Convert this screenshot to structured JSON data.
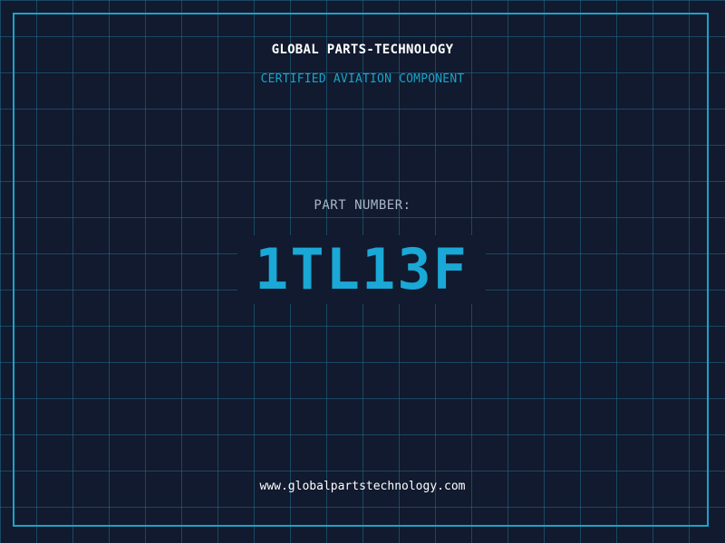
{
  "label": {
    "company": "GLOBAL PARTS-TECHNOLOGY",
    "subtitle": "CERTIFIED AVIATION COMPONENT",
    "part_number_label": "PART NUMBER:",
    "part_number": "1TL13F",
    "website": "www.globalpartstechnology.com"
  },
  "colors": {
    "background": "#111a2e",
    "grid": "#206e8c",
    "accent": "#1aa3c9",
    "text": "#ffffff",
    "muted": "#a9b7c8"
  }
}
